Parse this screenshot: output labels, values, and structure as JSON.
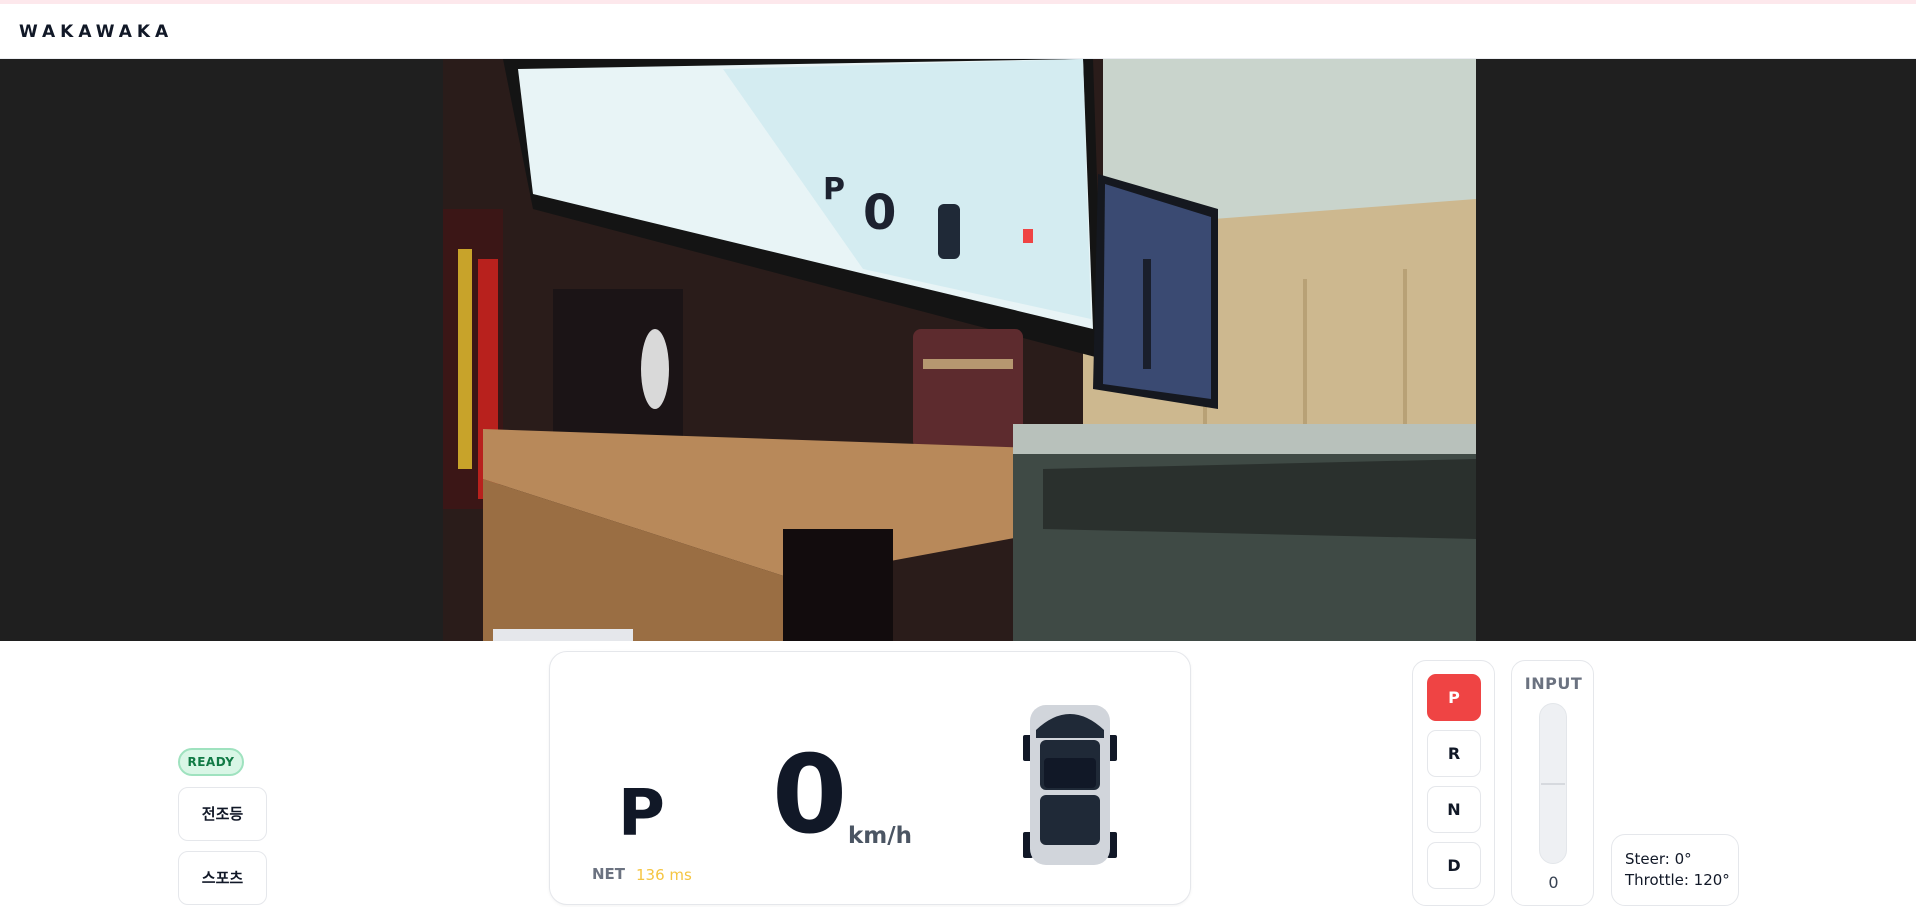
{
  "app": {
    "brand": "WAKAWAKA"
  },
  "status": {
    "ready_badge": "READY"
  },
  "controls": {
    "headlight_label": "전조등",
    "sport_label": "스포츠"
  },
  "dashboard": {
    "gear": "P",
    "speed": "0",
    "speed_unit": "km/h",
    "net_label": "NET",
    "net_latency": "136 ms"
  },
  "gear_selector": {
    "gears": [
      "P",
      "R",
      "N",
      "D"
    ],
    "active": "P"
  },
  "input_panel": {
    "title": "INPUT",
    "value": "0"
  },
  "telemetry": {
    "steer": "Steer: 0°",
    "throttle": "Throttle: 120°"
  },
  "colors": {
    "active_gear": "#ef4444",
    "ready_bg": "#d9f6e6",
    "ready_text": "#117a45",
    "latency": "#f5c542",
    "stage_bg": "#1f1f1f"
  }
}
